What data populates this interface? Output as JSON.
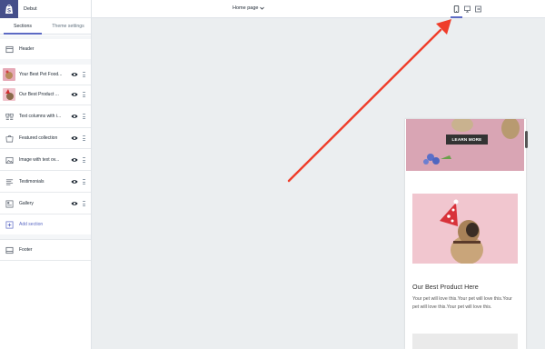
{
  "theme": {
    "name": "Debut"
  },
  "tabs": {
    "sections": "Sections",
    "theme_settings": "Theme settings"
  },
  "sections": {
    "header": "Header",
    "items": [
      {
        "label": "Your Best Pet Food...",
        "icon": "image-thumb"
      },
      {
        "label": "Our Best Product ...",
        "icon": "image-thumb"
      },
      {
        "label": "Text columns with i...",
        "icon": "text-columns-icon"
      },
      {
        "label": "Featured collection",
        "icon": "collection-icon"
      },
      {
        "label": "Image with text ov...",
        "icon": "image-icon"
      },
      {
        "label": "Testimonials",
        "icon": "testimonials-icon"
      },
      {
        "label": "Gallery",
        "icon": "gallery-icon"
      }
    ],
    "add_section": "Add section",
    "footer": "Footer"
  },
  "topbar": {
    "page_select": "Home page",
    "devices": [
      "mobile-icon",
      "desktop-icon",
      "fullscreen-icon"
    ],
    "active_device": "mobile"
  },
  "preview": {
    "hero_button": "LEARN MORE",
    "product_title": "Our Best Product Here",
    "product_text": "Your pet will love this.Your pet will love this.Your pet will love this.Your pet will love this."
  },
  "colors": {
    "accent": "#5c6ac4",
    "logo_bg": "#454f8a",
    "arrow": "#ef3d2a",
    "hero_pink": "#d9a5b4",
    "product_pink": "#f1c6cf"
  }
}
